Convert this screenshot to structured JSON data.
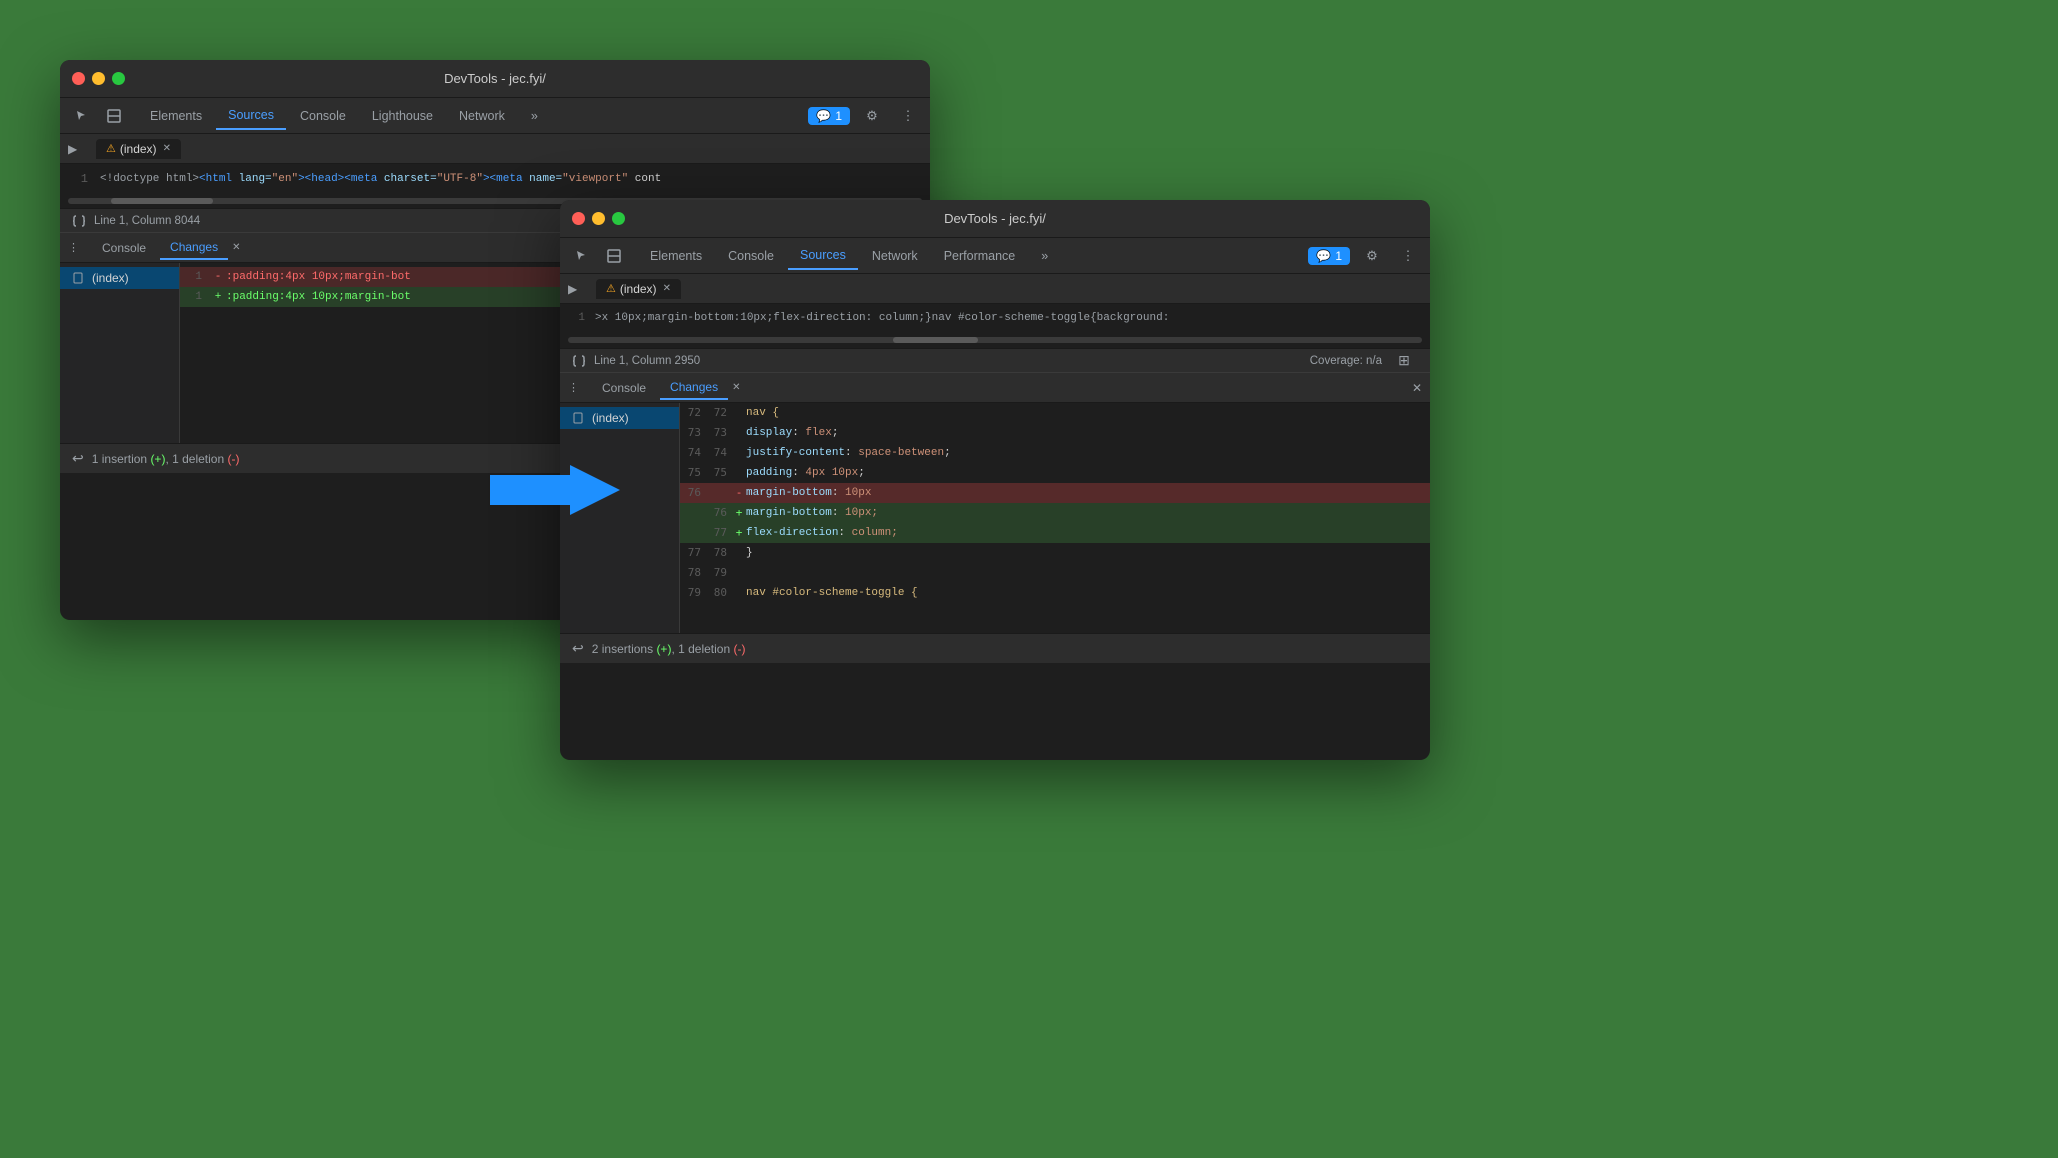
{
  "window1": {
    "title": "DevTools - jec.fyi/",
    "tabs": [
      {
        "label": "Elements",
        "active": false
      },
      {
        "label": "Sources",
        "active": true
      },
      {
        "label": "Console",
        "active": false
      },
      {
        "label": "Lighthouse",
        "active": false
      },
      {
        "label": "Network",
        "active": false
      }
    ],
    "file_tab": "(index)",
    "code_line_number": "1",
    "code_content": "<!doctype html><html lang=\"en\"><head><meta charset=\"UTF-8\"><meta name=\"viewport\" cont",
    "status": "Line 1, Column 8044",
    "panel_tabs": [
      {
        "label": "Console",
        "active": false
      },
      {
        "label": "Changes",
        "active": true
      }
    ],
    "file_list": [
      {
        "name": "(index)",
        "active": true
      }
    ],
    "diff_lines_header": [
      {
        "left": "1",
        "right": "",
        "marker": "-",
        "text": ":padding:4px 10px;margin-bot",
        "type": "removed"
      },
      {
        "left": "1",
        "right": "",
        "marker": "+",
        "text": ":padding:4px 10px;margin-bot",
        "type": "added"
      }
    ],
    "summary": "1 insertion (+), 1 deletion (-)",
    "badge_count": "1"
  },
  "window2": {
    "title": "DevTools - jec.fyi/",
    "tabs": [
      {
        "label": "Elements",
        "active": false
      },
      {
        "label": "Console",
        "active": false
      },
      {
        "label": "Sources",
        "active": true
      },
      {
        "label": "Network",
        "active": false
      },
      {
        "label": "Performance",
        "active": false
      }
    ],
    "file_tab": "(index)",
    "code_line_number": "1",
    "code_content": ">x 10px;margin-bottom:10px;flex-direction: column;}nav #color-scheme-toggle{background:",
    "status": "Line 1, Column 2950",
    "coverage": "Coverage: n/a",
    "panel_tabs": [
      {
        "label": "Console",
        "active": false
      },
      {
        "label": "Changes",
        "active": true
      }
    ],
    "file_list": [
      {
        "name": "(index)",
        "active": true
      }
    ],
    "diff_lines": [
      {
        "left": "72",
        "right": "72",
        "marker": "",
        "text": "        nav {",
        "type": "context"
      },
      {
        "left": "73",
        "right": "73",
        "marker": "",
        "text": "            display: flex;",
        "type": "context"
      },
      {
        "left": "74",
        "right": "74",
        "marker": "",
        "text": "            justify-content: space-between;",
        "type": "context"
      },
      {
        "left": "75",
        "right": "75",
        "marker": "",
        "text": "            padding: 4px 10px;",
        "type": "context"
      },
      {
        "left": "76",
        "right": "",
        "marker": "-",
        "text": "            margin-bottom: 10px",
        "type": "removed"
      },
      {
        "left": "",
        "right": "76",
        "marker": "+",
        "text": "            margin-bottom: 10px;",
        "type": "added"
      },
      {
        "left": "",
        "right": "77",
        "marker": "+",
        "text": "            flex-direction: column;",
        "type": "added"
      },
      {
        "left": "77",
        "right": "78",
        "marker": "",
        "text": "        }",
        "type": "context"
      },
      {
        "left": "78",
        "right": "79",
        "marker": "",
        "text": "",
        "type": "context"
      },
      {
        "left": "79",
        "right": "80",
        "marker": "",
        "text": "        nav #color-scheme-toggle {",
        "type": "context"
      }
    ],
    "summary": "2 insertions (+), 1 deletion (-)",
    "badge_count": "1"
  },
  "arrow": {
    "symbol": "→"
  }
}
